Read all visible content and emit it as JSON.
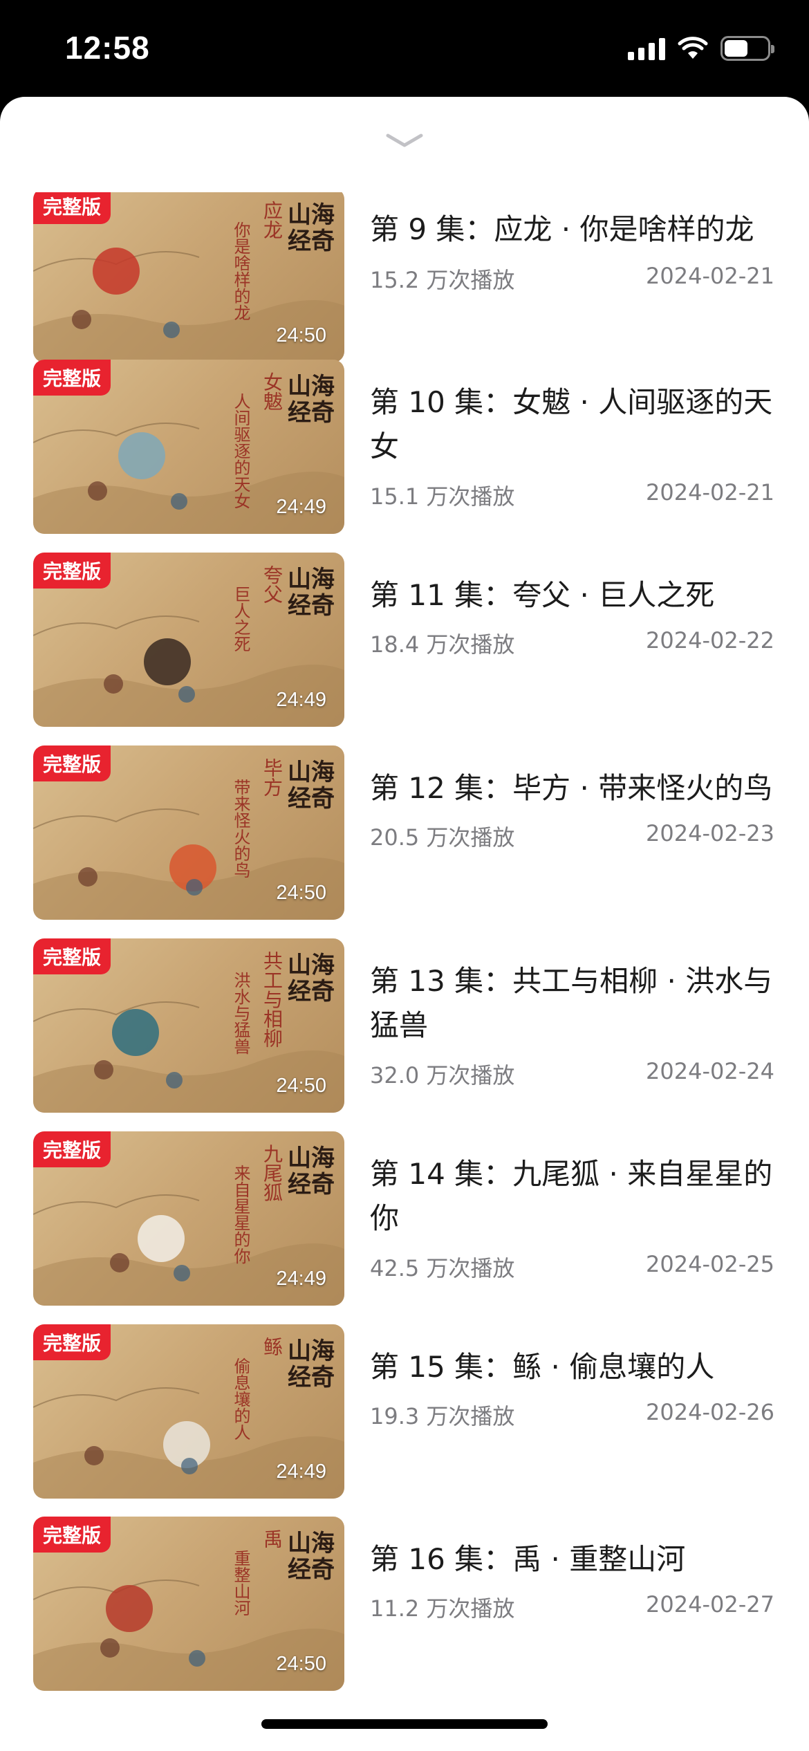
{
  "status": {
    "time": "12:58"
  },
  "sheet": {
    "collapse_icon": "chevron-down-icon"
  },
  "colors": {
    "badge": "#e8232f",
    "title_text": "#1c1c1c",
    "meta_text": "#7c7c80"
  },
  "thumb": {
    "logo": "山海经奇"
  },
  "episodes": [
    {
      "badge": "完整版",
      "title": "第 9 集：应龙 · 你是啥样的龙",
      "views": "15.2 万次播放",
      "date": "2024-02-21",
      "duration": "24:50",
      "thumb_title": "应龙",
      "thumb_sub": "你是啥样的龙"
    },
    {
      "badge": "完整版",
      "title": "第 10 集：女魃 · 人间驱逐的天女",
      "views": "15.1 万次播放",
      "date": "2024-02-21",
      "duration": "24:49",
      "thumb_title": "女魃",
      "thumb_sub": "人间驱逐的天女"
    },
    {
      "badge": "完整版",
      "title": "第 11 集：夸父 · 巨人之死",
      "views": "18.4 万次播放",
      "date": "2024-02-22",
      "duration": "24:49",
      "thumb_title": "夸父",
      "thumb_sub": "巨人之死"
    },
    {
      "badge": "完整版",
      "title": "第 12 集：毕方 · 带来怪火的鸟",
      "views": "20.5 万次播放",
      "date": "2024-02-23",
      "duration": "24:50",
      "thumb_title": "毕方",
      "thumb_sub": "带来怪火的鸟"
    },
    {
      "badge": "完整版",
      "title": "第 13 集：共工与相柳 · 洪水与猛兽",
      "views": "32.0 万次播放",
      "date": "2024-02-24",
      "duration": "24:50",
      "thumb_title": "共工与相柳",
      "thumb_sub": "洪水与猛兽"
    },
    {
      "badge": "完整版",
      "title": "第 14 集：九尾狐 · 来自星星的你",
      "views": "42.5 万次播放",
      "date": "2024-02-25",
      "duration": "24:49",
      "thumb_title": "九尾狐",
      "thumb_sub": "来自星星的你"
    },
    {
      "badge": "完整版",
      "title": "第 15 集：鲧 · 偷息壤的人",
      "views": "19.3 万次播放",
      "date": "2024-02-26",
      "duration": "24:49",
      "thumb_title": "鲧",
      "thumb_sub": "偷息壤的人"
    },
    {
      "badge": "完整版",
      "title": "第 16 集：禹 · 重整山河",
      "views": "11.2 万次播放",
      "date": "2024-02-27",
      "duration": "24:50",
      "thumb_title": "禹",
      "thumb_sub": "重整山河"
    }
  ]
}
